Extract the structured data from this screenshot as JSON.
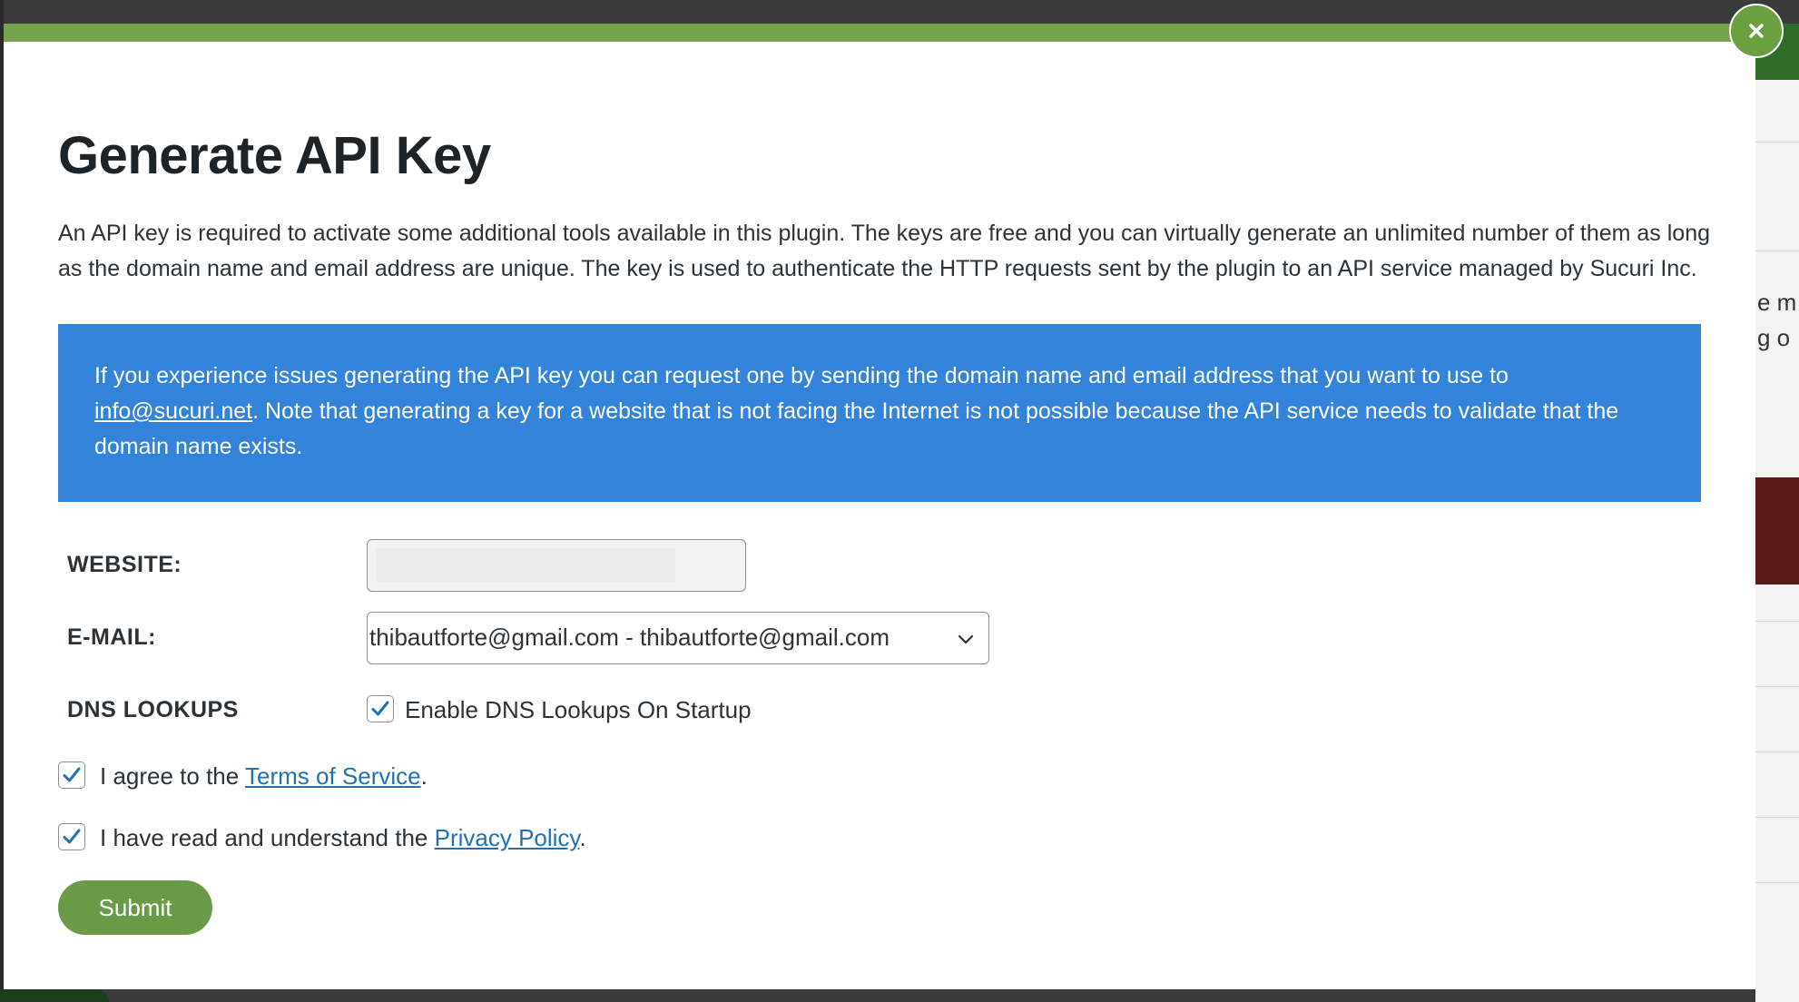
{
  "background_page": {
    "text_fragments": [
      "e m",
      "g o"
    ]
  },
  "modal": {
    "title": "Generate API Key",
    "close_label": "×",
    "intro": "An API key is required to activate some additional tools available in this plugin. The keys are free and you can virtually generate an unlimited number of them as long as the domain name and email address are unique. The key is used to authenticate the HTTP requests sent by the plugin to an API service managed by Sucuri Inc.",
    "notice": {
      "before_link": "If you experience issues generating the API key you can request one by sending the domain name and email address that you want to use to ",
      "link_text": "info@sucuri.net",
      "after_link": ". Note that generating a key for a website that is not facing the Internet is not possible because the API service needs to validate that the domain name exists."
    },
    "form": {
      "website_label": "WEBSITE:",
      "website_value": "",
      "email_label": "E-MAIL:",
      "email_value": "thibautforte@gmail.com - thibautforte@gmail.com",
      "dns_label": "DNS LOOKUPS",
      "dns_checkbox_label": "Enable DNS Lookups On Startup",
      "dns_checked": true,
      "tos_before": "I agree to the ",
      "tos_link": "Terms of Service",
      "tos_after": ".",
      "tos_checked": true,
      "privacy_before": "I have read and understand the ",
      "privacy_link": "Privacy Policy",
      "privacy_after": ".",
      "privacy_checked": true,
      "submit_label": "Submit"
    }
  },
  "colors": {
    "accent_green": "#76a34b",
    "notice_blue": "#3283d9",
    "link_blue": "#2271b1",
    "check_blue": "#2271b1"
  }
}
